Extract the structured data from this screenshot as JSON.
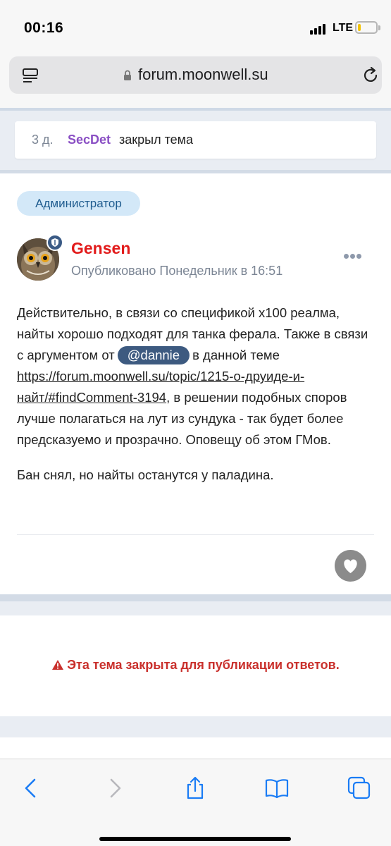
{
  "status_bar": {
    "time": "00:16",
    "network": "LTE",
    "battery_level": 0.15
  },
  "browser": {
    "url": "forum.moonwell.su",
    "icons": [
      "reader-view-icon",
      "lock-icon",
      "reload-icon"
    ]
  },
  "event": {
    "time": "3 д.",
    "user": "SecDet",
    "action": "закрыл тема"
  },
  "post": {
    "role_badge": "Администратор",
    "author": "Gensen",
    "published": "Опубликовано Понедельник в 16:51",
    "body": {
      "p1_a": "Действительно, в связи со спецификой x100 реалма, найты хорошо подходят для танка ферала. Также в связи с аргументом от",
      "mention": "@dannie",
      "p1_b": "в данной теме",
      "link": "https://forum.moonwell.su/topic/1215-о-друиде-и-найт/#findComment-3194",
      "p1_c": ", в решении подобных споров лучше полагаться на лут из сундука - так будет более предсказуемо и прозрачно. Оповещу об этом ГМов.",
      "p2": "Бан снял, но найты останутся у паладина."
    }
  },
  "locked_notice": "Эта тема закрыта для публикации ответов.",
  "colors": {
    "author": "#e21b1b",
    "event_user": "#8a4fc4",
    "role_badge_bg": "#d3e8f8",
    "mention_bg": "#3d5a80",
    "locked": "#c9302c",
    "ios_blue": "#1a7cf5"
  },
  "toolbar": {
    "icons": [
      "back-icon",
      "forward-icon",
      "share-icon",
      "bookmarks-icon",
      "tabs-icon"
    ]
  }
}
